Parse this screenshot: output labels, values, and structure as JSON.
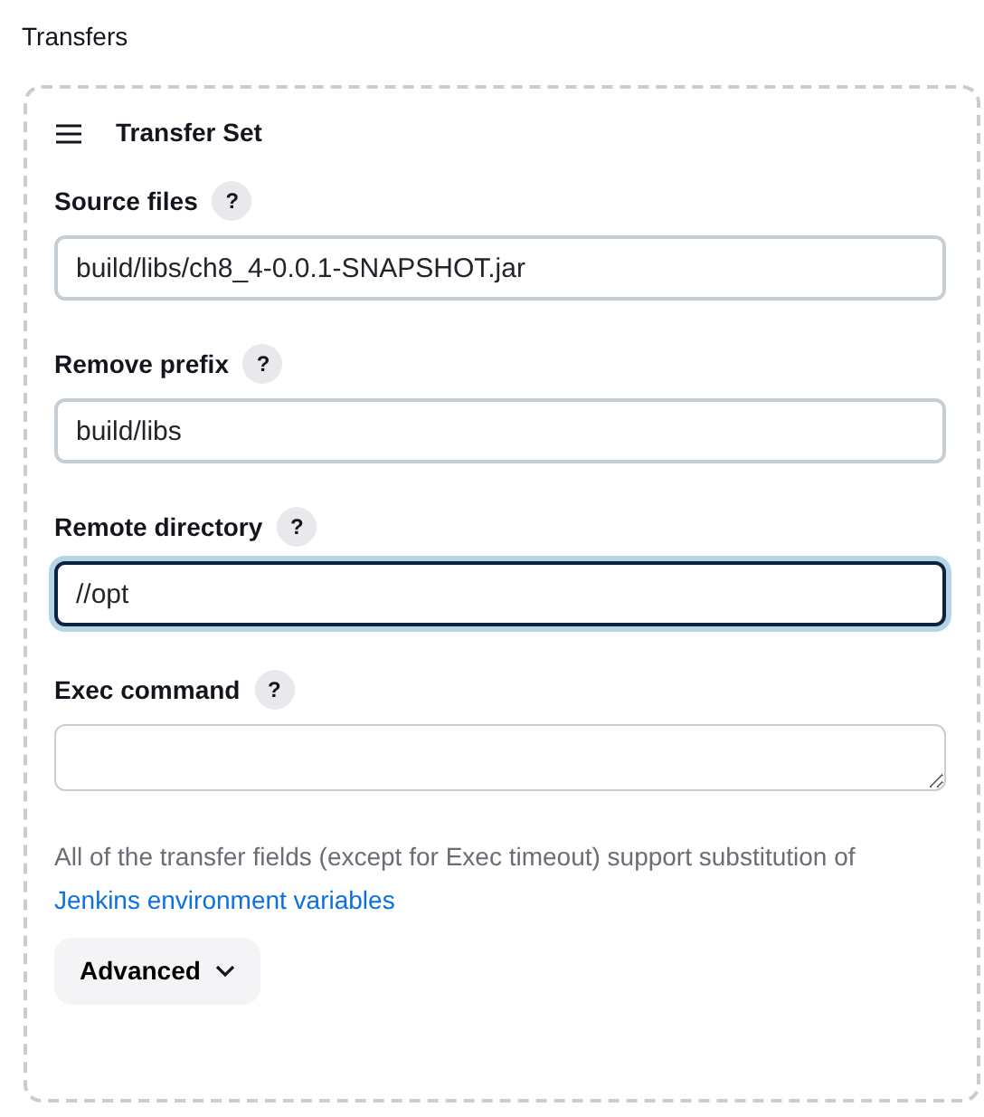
{
  "section_title": "Transfers",
  "transfer_set": {
    "title": "Transfer Set",
    "fields": [
      {
        "label": "Source files",
        "help": "?",
        "kind": "input",
        "value": "build/libs/ch8_4-0.0.1-SNAPSHOT.jar",
        "focused": false
      },
      {
        "label": "Remove prefix",
        "help": "?",
        "kind": "input",
        "value": "build/libs",
        "focused": false
      },
      {
        "label": "Remote directory",
        "help": "?",
        "kind": "input",
        "value": "//opt",
        "focused": true
      },
      {
        "label": "Exec command",
        "help": "?",
        "kind": "textarea",
        "focused": false
      }
    ],
    "note": "All of the transfer fields (except for Exec timeout) support substitution of",
    "note_link": "Jenkins environment variables",
    "advanced_button": "Advanced"
  }
}
